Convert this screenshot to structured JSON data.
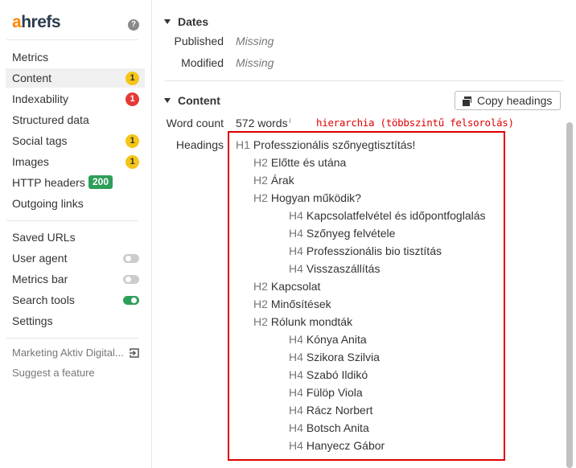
{
  "app": {
    "logo_a": "a",
    "logo_rest": "hrefs",
    "help_icon": "question-circle-icon"
  },
  "sidebar": {
    "items": [
      {
        "label": "Metrics"
      },
      {
        "label": "Content",
        "badge": "1",
        "active": true
      },
      {
        "label": "Indexability",
        "badge": "1"
      },
      {
        "label": "Structured data"
      },
      {
        "label": "Social tags",
        "badge": "1"
      },
      {
        "label": "Images",
        "badge": "1"
      },
      {
        "label": "HTTP headers",
        "badge": "200"
      },
      {
        "label": "Outgoing links"
      }
    ],
    "tools": [
      {
        "label": "Saved URLs"
      },
      {
        "label": "User agent",
        "toggle": "off"
      },
      {
        "label": "Metrics bar",
        "toggle": "off"
      },
      {
        "label": "Search tools",
        "toggle": "on"
      },
      {
        "label": "Settings"
      }
    ],
    "account": "Marketing Aktiv Digital...",
    "suggest": "Suggest a feature",
    "colors": {
      "badge_yellow": "#f5c518",
      "badge_red": "#e53935",
      "badge_green": "#2e9e58"
    }
  },
  "dates": {
    "title": "Dates",
    "published_label": "Published",
    "published_value": "Missing",
    "modified_label": "Modified",
    "modified_value": "Missing"
  },
  "content": {
    "title": "Content",
    "copy_button": "Copy headings",
    "word_count_label": "Word count",
    "word_count_value": "572 words",
    "info_mark": "i",
    "annotation": "hierarchia (többszintű felsorolás)",
    "headings_label": "Headings",
    "headings": [
      {
        "tag": "H1",
        "text": "Professzionális szőnyegtisztítás!"
      },
      {
        "tag": "H2",
        "text": "Előtte és utána"
      },
      {
        "tag": "H2",
        "text": "Árak"
      },
      {
        "tag": "H2",
        "text": "Hogyan működik?"
      },
      {
        "tag": "H4",
        "text": "Kapcsolatfelvétel és időpontfoglalás"
      },
      {
        "tag": "H4",
        "text": "Szőnyeg felvétele"
      },
      {
        "tag": "H4",
        "text": "Professzionális bio tisztítás"
      },
      {
        "tag": "H4",
        "text": "Visszaszállítás"
      },
      {
        "tag": "H2",
        "text": "Kapcsolat"
      },
      {
        "tag": "H2",
        "text": "Minősítések"
      },
      {
        "tag": "H2",
        "text": "Rólunk mondták"
      },
      {
        "tag": "H4",
        "text": "Kónya Anita"
      },
      {
        "tag": "H4",
        "text": "Szikora Szilvia"
      },
      {
        "tag": "H4",
        "text": "Szabó Ildikó"
      },
      {
        "tag": "H4",
        "text": "Fülöp Viola"
      },
      {
        "tag": "H4",
        "text": "Rácz Norbert"
      },
      {
        "tag": "H4",
        "text": "Botsch Anita"
      },
      {
        "tag": "H4",
        "text": "Hanyecz Gábor"
      }
    ]
  }
}
